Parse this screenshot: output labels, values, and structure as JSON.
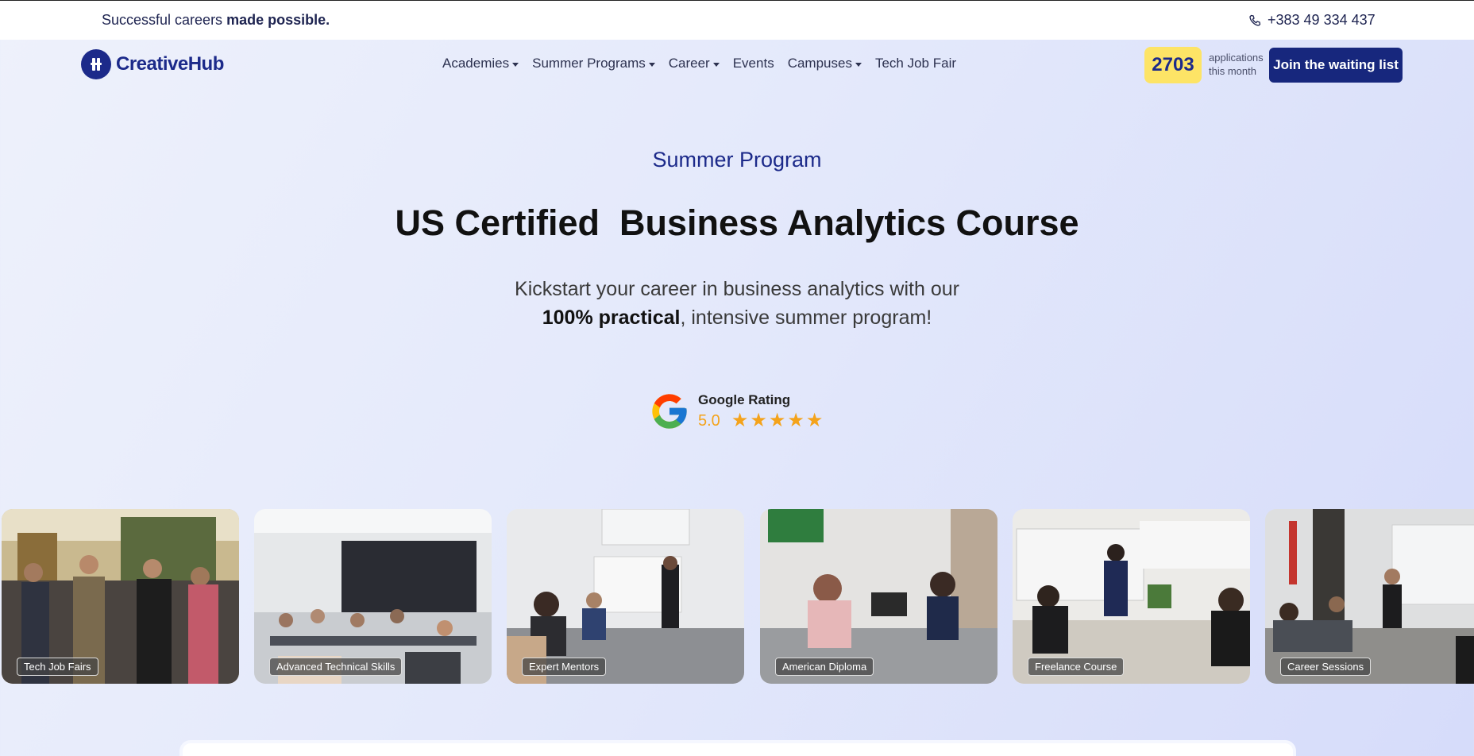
{
  "topbar": {
    "tagline_light": "Successful careers",
    "tagline_bold": "made possible.",
    "phone": "+383 49 334 437"
  },
  "brand": {
    "name": "CreativeHub"
  },
  "nav": {
    "items": [
      {
        "label": "Academies",
        "dropdown": true
      },
      {
        "label": "Summer Programs",
        "dropdown": true
      },
      {
        "label": "Career",
        "dropdown": true
      },
      {
        "label": "Events",
        "dropdown": false
      },
      {
        "label": "Campuses",
        "dropdown": true
      },
      {
        "label": "Tech Job Fair",
        "dropdown": false
      }
    ]
  },
  "applications": {
    "count": "2703",
    "label_line1": "applications",
    "label_line2": "this month"
  },
  "cta": {
    "waitlist_label": "Join the waiting list"
  },
  "hero": {
    "eyebrow": "Summer Program",
    "headline": "US Certified  Business Analytics Course",
    "sub_line1": "Kickstart your career in business analytics with our",
    "sub_bold": "100% practical",
    "sub_line2_rest": ", intensive summer program!"
  },
  "rating": {
    "label": "Google Rating",
    "score": "5.0",
    "stars": 5
  },
  "gallery": {
    "items": [
      {
        "label": "Tech Job Fairs"
      },
      {
        "label": "Advanced Technical Skills"
      },
      {
        "label": "Expert Mentors"
      },
      {
        "label": "American Diploma"
      },
      {
        "label": "Freelance Course"
      },
      {
        "label": "Career Sessions"
      }
    ]
  },
  "colors": {
    "brand": "#17277d",
    "accent_yellow": "#fde466",
    "star": "#f4a31b"
  }
}
